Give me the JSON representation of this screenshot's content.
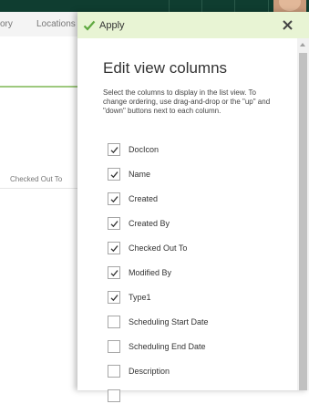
{
  "background": {
    "nav_fragment": "ory",
    "nav_locations": "Locations",
    "column_header": "Checked Out To"
  },
  "panel": {
    "apply_label": "Apply",
    "close_icon": "close-icon",
    "title": "Edit view columns",
    "description": "Select the columns to display in the list view. To change ordering, use drag-and-drop or the \"up\" and \"down\" buttons next to each column.",
    "columns": [
      {
        "label": "DocIcon",
        "checked": true
      },
      {
        "label": "Name",
        "checked": true
      },
      {
        "label": "Created",
        "checked": true
      },
      {
        "label": "Created By",
        "checked": true
      },
      {
        "label": "Checked Out To",
        "checked": true
      },
      {
        "label": "Modified By",
        "checked": true
      },
      {
        "label": "Type1",
        "checked": true
      },
      {
        "label": "Scheduling Start Date",
        "checked": false
      },
      {
        "label": "Scheduling End Date",
        "checked": false
      },
      {
        "label": "Description",
        "checked": false
      },
      {
        "label": "",
        "checked": false
      }
    ]
  },
  "colors": {
    "header_bg": "#0f3d30",
    "command_bar_bg": "#e8f4d4",
    "accent_green": "#5ea83f"
  }
}
